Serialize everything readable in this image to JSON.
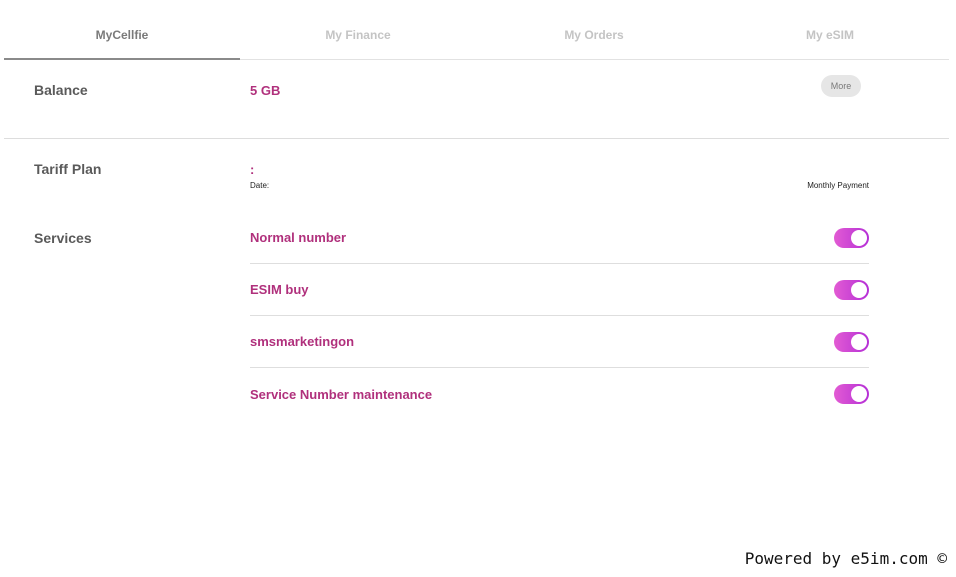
{
  "tabs": [
    {
      "label": "MyCellfie",
      "active": true
    },
    {
      "label": "My Finance",
      "active": false
    },
    {
      "label": "My Orders",
      "active": false
    },
    {
      "label": "My eSIM",
      "active": false
    }
  ],
  "balance": {
    "label": "Balance",
    "value": "5 GB",
    "more_label": "More"
  },
  "tariff": {
    "label": "Tariff Plan",
    "name": ":",
    "date_label": "Date:",
    "payment_label": "Monthly Payment"
  },
  "services": {
    "label": "Services",
    "items": [
      {
        "name": "Normal number",
        "enabled": true
      },
      {
        "name": "ESIM buy",
        "enabled": true
      },
      {
        "name": "smsmarketingon",
        "enabled": true
      },
      {
        "name": "Service Number maintenance",
        "enabled": true
      }
    ]
  },
  "footer": {
    "text": "Powered by e5im.com ©"
  },
  "colors": {
    "accent": "#b0307c",
    "toggle_start": "#e25bd3",
    "toggle_end": "#b52fd6"
  }
}
